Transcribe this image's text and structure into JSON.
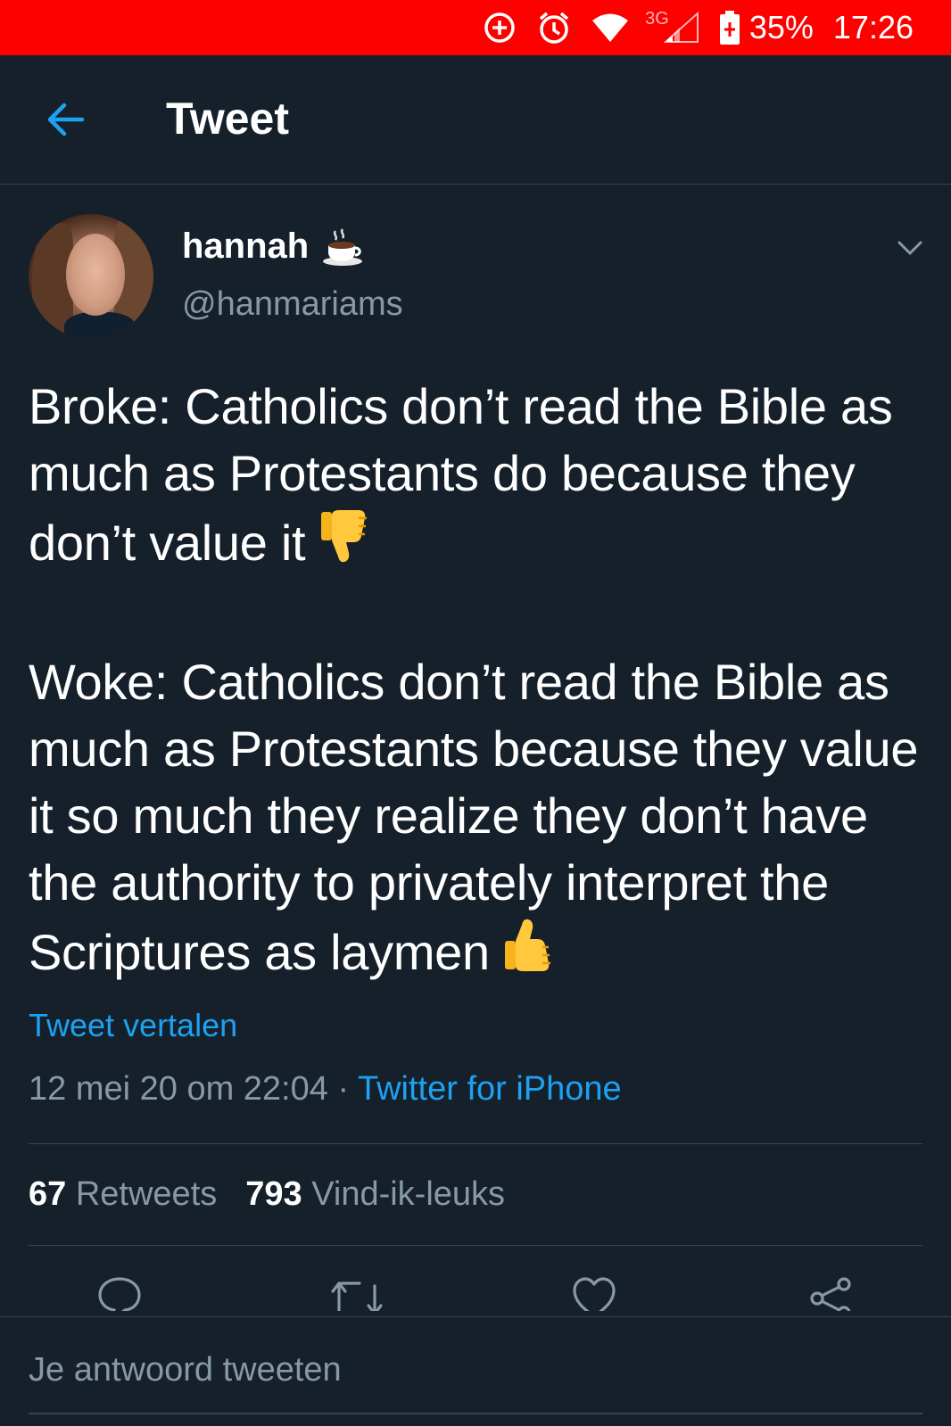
{
  "status_bar": {
    "network": "3G",
    "battery": "35%",
    "time": "17:26",
    "icons": [
      "data-saver-icon",
      "alarm-icon",
      "wifi-icon",
      "signal-icon",
      "battery-charging-icon"
    ]
  },
  "header": {
    "title": "Tweet",
    "back_icon": "back-arrow-icon"
  },
  "tweet": {
    "author": {
      "display_name": "hannah",
      "name_emoji": "hot-beverage-emoji",
      "handle": "@hanmariams"
    },
    "paragraph_1": "Broke: Catholics don’t read the Bible as much as Protestants do because they don’t value it",
    "paragraph_1_emoji": "thumbs-down-emoji",
    "paragraph_2": "Woke: Catholics don’t read the Bible as much as Protestants because they value it so much they realize they don’t have the authority to privately interpret the Scriptures as laymen",
    "paragraph_2_emoji": "thumbs-up-emoji",
    "translate_label": "Tweet vertalen",
    "timestamp": "12 mei 20 om 22:04",
    "separator": " · ",
    "source": "Twitter for iPhone",
    "retweets_count": "67",
    "retweets_label": "Retweets",
    "likes_count": "793",
    "likes_label": "Vind-ik-leuks"
  },
  "actions": [
    "reply-icon",
    "retweet-icon",
    "like-icon",
    "share-icon"
  ],
  "reply": {
    "placeholder": "Je antwoord tweeten"
  },
  "colors": {
    "status_bar": "#fd0000",
    "background": "#15202b",
    "accent": "#1da1f2",
    "secondary_text": "#8899a6",
    "divider": "#38444d"
  }
}
